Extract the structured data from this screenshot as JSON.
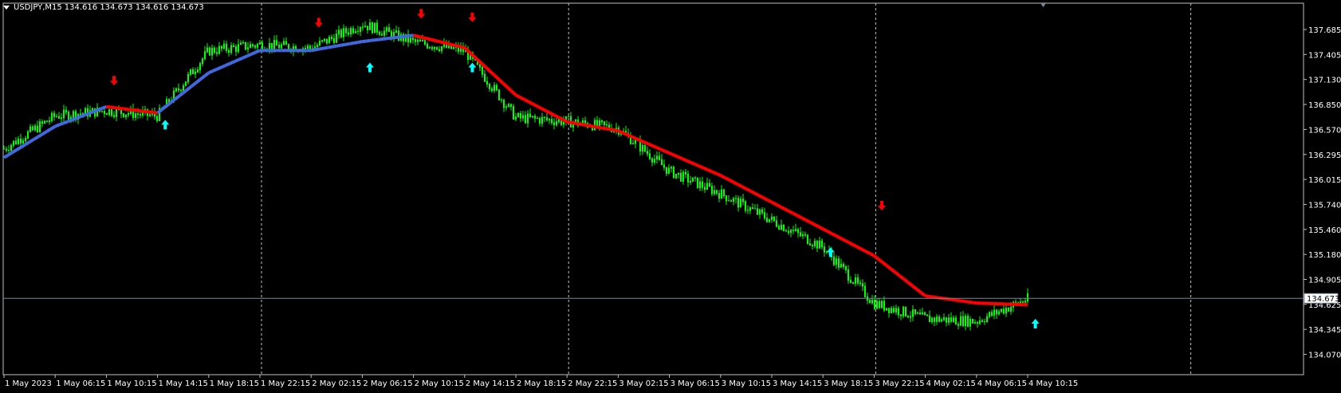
{
  "window": {
    "symbol_tf": "USDJPY,M15",
    "ohlc": "134.616 134.673 134.616 134.673",
    "menu_icon": "triangle-down-icon"
  },
  "colors": {
    "background": "#000000",
    "frame": "#c0c0c0",
    "candle": "#00ff00",
    "ma_up": "#4169e1",
    "ma_down": "#ff0000",
    "arrow_buy": "#00ffff",
    "arrow_sell": "#ff0000",
    "grid_separator": "#c0c0c0",
    "bid_line": "#778899",
    "text": "#ffffff"
  },
  "price_axis": {
    "labels": [
      "137.685",
      "137.405",
      "137.130",
      "136.850",
      "136.570",
      "136.295",
      "136.015",
      "135.740",
      "135.460",
      "135.180",
      "134.905",
      "134.625",
      "134.345",
      "134.070"
    ],
    "current_price": "134.673"
  },
  "time_axis": {
    "labels": [
      "1 May 2023",
      "1 May 06:15",
      "1 May 10:15",
      "1 May 14:15",
      "1 May 18:15",
      "1 May 22:15",
      "2 May 02:15",
      "2 May 06:15",
      "2 May 10:15",
      "2 May 14:15",
      "2 May 18:15",
      "2 May 22:15",
      "3 May 02:15",
      "3 May 06:15",
      "3 May 10:15",
      "3 May 14:15",
      "3 May 18:15",
      "3 May 22:15",
      "4 May 02:15",
      "4 May 06:15",
      "4 May 10:15"
    ]
  },
  "chart_data": {
    "type": "line",
    "title": "USDJPY,M15",
    "ylim": [
      134.07,
      137.685
    ],
    "x": [
      "1 May 2023",
      "1 May 06:15",
      "1 May 10:15",
      "1 May 14:15",
      "1 May 18:15",
      "1 May 22:15",
      "2 May 02:15",
      "2 May 06:15",
      "2 May 10:15",
      "2 May 14:15",
      "2 May 18:15",
      "2 May 22:15",
      "3 May 02:15",
      "3 May 06:15",
      "3 May 10:15",
      "3 May 14:15",
      "3 May 18:15",
      "3 May 22:15",
      "4 May 02:15",
      "4 May 06:15",
      "4 May 10:15"
    ],
    "series": [
      {
        "values": [
          136.35,
          136.72,
          136.78,
          136.72,
          137.45,
          137.52,
          137.48,
          137.75,
          137.55,
          137.45,
          136.7,
          136.66,
          136.58,
          136.1,
          135.85,
          135.55,
          135.25,
          134.62,
          134.45,
          134.42,
          134.67
        ]
      }
    ],
    "ma": [
      136.25,
      136.6,
      136.82,
      136.75,
      137.2,
      137.45,
      137.45,
      137.55,
      137.62,
      137.48,
      136.95,
      136.65,
      136.55,
      136.3,
      136.05,
      135.75,
      135.45,
      135.15,
      134.7,
      134.62,
      134.6
    ],
    "buy_signals": [
      {
        "x": "1 May 14:15",
        "y": 136.78
      },
      {
        "x": "2 May 06:15",
        "y": 137.42
      },
      {
        "x": "2 May 14:15",
        "y": 137.42
      },
      {
        "x": "3 May 18:15",
        "y": 135.35
      },
      {
        "x": "4 May 10:15",
        "y": 134.55
      }
    ],
    "sell_signals": [
      {
        "x": "1 May 10:15",
        "y": 136.95
      },
      {
        "x": "2 May 02:15",
        "y": 137.6
      },
      {
        "x": "2 May 10:15",
        "y": 137.7
      },
      {
        "x": "2 May 14:15",
        "y": 137.66
      },
      {
        "x": "3 May 22:15",
        "y": 135.55
      }
    ],
    "separators": [
      "1 May 22:15",
      "2 May 22:15",
      "3 May 22:15",
      "4 May 22:15"
    ]
  }
}
